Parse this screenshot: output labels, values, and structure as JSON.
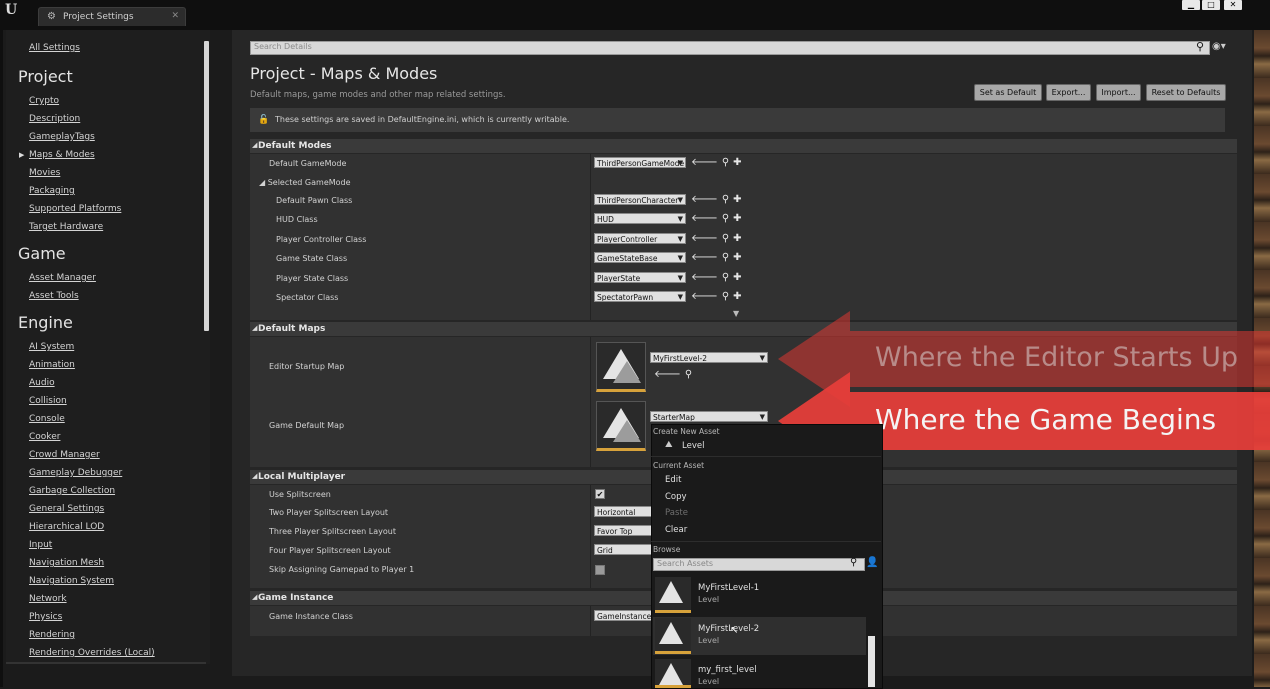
{
  "window": {
    "tab_title": "Project Settings",
    "tab_icon": "gear-icon",
    "controls": [
      "minimize-icon",
      "maximize-icon",
      "close-icon"
    ]
  },
  "sidebar": {
    "top_link": "All Settings",
    "groups": [
      {
        "title": "Project",
        "items": [
          "Crypto",
          "Description",
          "GameplayTags",
          "Maps & Modes",
          "Movies",
          "Packaging",
          "Supported Platforms",
          "Target Hardware"
        ],
        "selected": "Maps & Modes"
      },
      {
        "title": "Game",
        "items": [
          "Asset Manager",
          "Asset Tools"
        ]
      },
      {
        "title": "Engine",
        "items": [
          "AI System",
          "Animation",
          "Audio",
          "Collision",
          "Console",
          "Cooker",
          "Crowd Manager",
          "Gameplay Debugger",
          "Garbage Collection",
          "General Settings",
          "Hierarchical LOD",
          "Input",
          "Navigation Mesh",
          "Navigation System",
          "Network",
          "Physics",
          "Rendering",
          "Rendering Overrides (Local)"
        ]
      }
    ]
  },
  "main": {
    "search_placeholder": "Search Details",
    "title": "Project - Maps & Modes",
    "subtitle": "Default maps, game modes and other map related settings.",
    "buttons": {
      "set_default": "Set as Default",
      "export": "Export...",
      "import": "Import...",
      "reset": "Reset to Defaults"
    },
    "notice": "These settings are saved in DefaultEngine.ini, which is currently writable.",
    "sections": {
      "default_modes": {
        "title": "Default Modes",
        "default_gamemode_label": "Default GameMode",
        "default_gamemode_value": "ThirdPersonGameMode",
        "selected_gamemode_label": "Selected GameMode",
        "rows": [
          {
            "label": "Default Pawn Class",
            "value": "ThirdPersonCharacter"
          },
          {
            "label": "HUD Class",
            "value": "HUD"
          },
          {
            "label": "Player Controller Class",
            "value": "PlayerController"
          },
          {
            "label": "Game State Class",
            "value": "GameStateBase"
          },
          {
            "label": "Player State Class",
            "value": "PlayerState"
          },
          {
            "label": "Spectator Class",
            "value": "SpectatorPawn"
          }
        ]
      },
      "default_maps": {
        "title": "Default Maps",
        "editor_startup_label": "Editor Startup Map",
        "editor_startup_value": "MyFirstLevel-2",
        "game_default_label": "Game Default Map",
        "game_default_value": "StarterMap"
      },
      "local_multiplayer": {
        "title": "Local Multiplayer",
        "use_splitscreen_label": "Use Splitscreen",
        "use_splitscreen_checked": true,
        "two_player_label": "Two Player Splitscreen Layout",
        "two_player_value": "Horizontal",
        "three_player_label": "Three Player Splitscreen Layout",
        "three_player_value": "Favor Top",
        "four_player_label": "Four Player Splitscreen Layout",
        "four_player_value": "Grid",
        "skip_gamepad_label": "Skip Assigning Gamepad to Player 1",
        "skip_gamepad_checked": false
      },
      "game_instance": {
        "title": "Game Instance",
        "class_label": "Game Instance Class",
        "class_value": "GameInstance"
      }
    }
  },
  "dropdown_menu": {
    "create_header": "Create New Asset",
    "create_item": "Level",
    "current_header": "Current Asset",
    "current_items": [
      "Edit",
      "Copy",
      "Paste",
      "Clear"
    ],
    "browse_header": "Browse",
    "search_placeholder": "Search Assets",
    "assets": [
      {
        "name": "MyFirstLevel-1",
        "type": "Level"
      },
      {
        "name": "MyFirstLevel-2",
        "type": "Level"
      },
      {
        "name": "my_first_level",
        "type": "Level"
      }
    ]
  },
  "callouts": {
    "editor": "Where the Editor Starts Up",
    "game": "Where the Game Begins",
    "color": "#e83e3a"
  }
}
